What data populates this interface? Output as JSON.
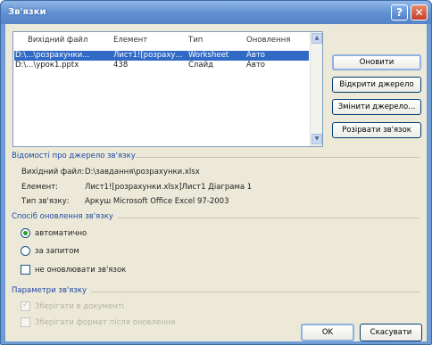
{
  "window": {
    "title": "Зв'язки"
  },
  "titlebar_buttons": {
    "help": "?",
    "close": "✕"
  },
  "links_list": {
    "columns": [
      "Вихідний файл",
      "Елемент",
      "Тип",
      "Оновлення"
    ],
    "rows": [
      {
        "file": "D:\\...\\розрахунки...",
        "element": "Лист1![розраху...",
        "type": "Worksheet",
        "update": "Авто",
        "selected": true
      },
      {
        "file": "D:\\...\\урок1.pptx",
        "element": "438",
        "type": "Слайд",
        "update": "Авто",
        "selected": false
      }
    ]
  },
  "buttons": {
    "update": "Оновити",
    "open_source": "Відкрити джерело",
    "change_source": "Змінити джерело...",
    "break_link": "Розірвати зв'язок",
    "ok": "OK",
    "cancel": "Скасувати"
  },
  "source_info": {
    "title": "Відомості про джерело зв'язку",
    "source_file_label": "Вихідний файл:",
    "source_file_value": "D:\\завдання\\розрахунки.xlsx",
    "element_label": "Елемент:",
    "element_value": "Лист1![розрахунки.xlsx]Лист1 Діаграма 1",
    "type_label": "Тип зв'язку:",
    "type_value": "Аркуш Microsoft Office Excel 97-2003"
  },
  "update_method": {
    "title": "Спосіб оновлення зв'язку",
    "automatic": "автоматично",
    "on_request": "за запитом",
    "no_update": "не оновлювати зв'язок",
    "selected": "automatic"
  },
  "link_params": {
    "title": "Параметри зв'язку",
    "save_in_document": "Зберігати в документі",
    "save_format": "Зберігати формат після оновлення"
  }
}
